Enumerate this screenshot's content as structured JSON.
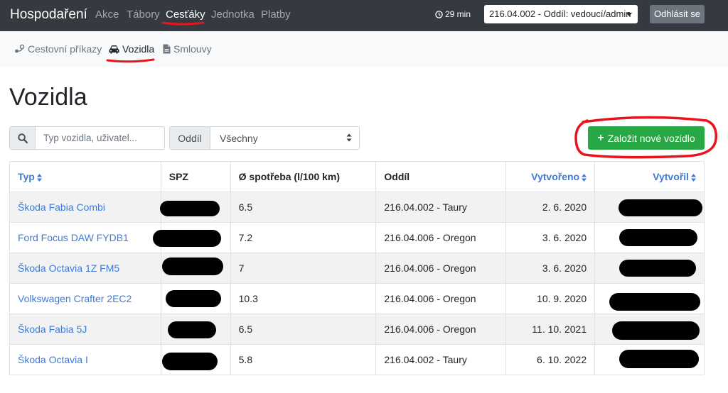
{
  "navbar": {
    "brand": "Hospodaření",
    "items": [
      {
        "label": "Akce",
        "active": false
      },
      {
        "label": "Tábory",
        "active": false
      },
      {
        "label": "Cesťáky",
        "active": true
      },
      {
        "label": "Jednotka",
        "active": false
      },
      {
        "label": "Platby",
        "active": false
      }
    ],
    "timer": "29 min",
    "unit_select": "216.04.002 - Oddíl: vedoucí/admin",
    "logout_label": "Odhlásit se"
  },
  "subnav": {
    "items": [
      {
        "label": "Cestovní příkazy",
        "icon": "route-icon",
        "active": false
      },
      {
        "label": "Vozidla",
        "icon": "car-icon",
        "active": true
      },
      {
        "label": "Smlouvy",
        "icon": "document-icon",
        "active": false
      }
    ]
  },
  "page": {
    "title": "Vozidla",
    "search_placeholder": "Typ vozidla, uživatel...",
    "filter_label": "Oddíl",
    "filter_value": "Všechny",
    "create_label": "Založit nové vozidlo"
  },
  "table": {
    "headers": [
      "Typ",
      "SPZ",
      "Ø spotřeba (l/100 km)",
      "Oddíl",
      "Vytvořeno",
      "Vytvořil"
    ],
    "rows": [
      {
        "type": "Škoda Fabia Combi",
        "consumption": "6.5",
        "unit": "216.04.002 - Taury",
        "created": "2. 6. 2020"
      },
      {
        "type": "Ford Focus DAW FYDB1",
        "consumption": "7.2",
        "unit": "216.04.006 - Oregon",
        "created": "3. 6. 2020"
      },
      {
        "type": "Škoda Octavia 1Z FM5",
        "consumption": "7",
        "unit": "216.04.006 - Oregon",
        "created": "3. 6. 2020"
      },
      {
        "type": "Volkswagen Crafter 2EC2",
        "consumption": "10.3",
        "unit": "216.04.006 - Oregon",
        "created": "10. 9. 2020"
      },
      {
        "type": "Škoda Fabia 5J",
        "consumption": "6.5",
        "unit": "216.04.006 - Oregon",
        "created": "11. 10. 2021"
      },
      {
        "type": "Škoda Octavia I",
        "consumption": "5.8",
        "unit": "216.04.002 - Taury",
        "created": "6. 10. 2022"
      }
    ]
  },
  "colors": {
    "navbar": "#343a40",
    "link": "#3e7bd6",
    "success": "#28a745",
    "annotation": "#e8141c"
  }
}
